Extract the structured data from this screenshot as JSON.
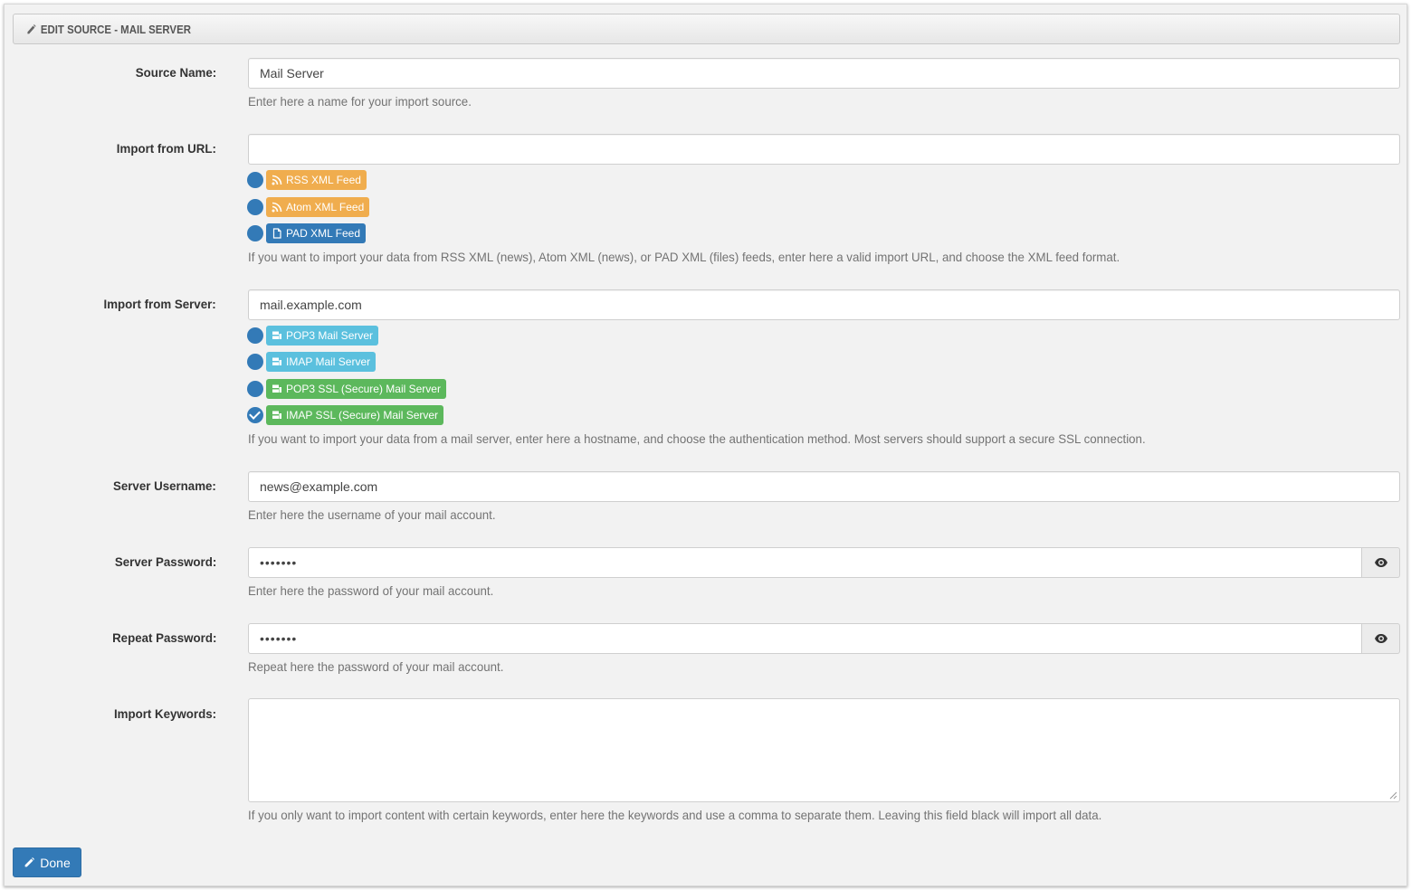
{
  "header": {
    "title": "EDIT SOURCE - MAIL SERVER",
    "icon": "pencil-icon"
  },
  "source_name": {
    "label": "Source Name:",
    "value": "Mail Server",
    "help": "Enter here a name for your import source."
  },
  "import_url": {
    "label": "Import from URL:",
    "value": "",
    "options": [
      {
        "label": "RSS XML Feed",
        "icon": "rss-icon",
        "color": "#f0ad4e",
        "checked": false
      },
      {
        "label": "Atom XML Feed",
        "icon": "rss-icon",
        "color": "#f0ad4e",
        "checked": false
      },
      {
        "label": "PAD XML Feed",
        "icon": "file-icon",
        "color": "#337ab7",
        "checked": false
      }
    ],
    "help": "If you want to import your data from RSS XML (news), Atom XML (news), or PAD XML (files) feeds, enter here a valid import URL, and choose the XML feed format."
  },
  "import_server": {
    "label": "Import from Server:",
    "value": "mail.example.com",
    "options": [
      {
        "label": "POP3 Mail Server",
        "icon": "server-icon",
        "color": "#5bc0de",
        "checked": false
      },
      {
        "label": "IMAP Mail Server",
        "icon": "server-icon",
        "color": "#5bc0de",
        "checked": false
      },
      {
        "label": "POP3 SSL (Secure) Mail Server",
        "icon": "server-icon",
        "color": "#5cb85c",
        "checked": false
      },
      {
        "label": "IMAP SSL (Secure) Mail Server",
        "icon": "server-icon",
        "color": "#5cb85c",
        "checked": true
      }
    ],
    "help": "If you want to import your data from a mail server, enter here a hostname, and choose the authentication method. Most servers should support a secure SSL connection."
  },
  "server_username": {
    "label": "Server Username:",
    "value": "news@example.com",
    "help": "Enter here the username of your mail account."
  },
  "server_password": {
    "label": "Server Password:",
    "value": "•••••••",
    "help": "Enter here the password of your mail account."
  },
  "repeat_password": {
    "label": "Repeat Password:",
    "value": "•••••••",
    "help": "Repeat here the password of your mail account."
  },
  "import_keywords": {
    "label": "Import Keywords:",
    "value": "",
    "help": "If you only want to import content with certain keywords, enter here the keywords and use a comma to separate them. Leaving this field black will import all data."
  },
  "done_button": {
    "label": "Done",
    "icon": "pencil-icon",
    "color": "#337ab7"
  }
}
